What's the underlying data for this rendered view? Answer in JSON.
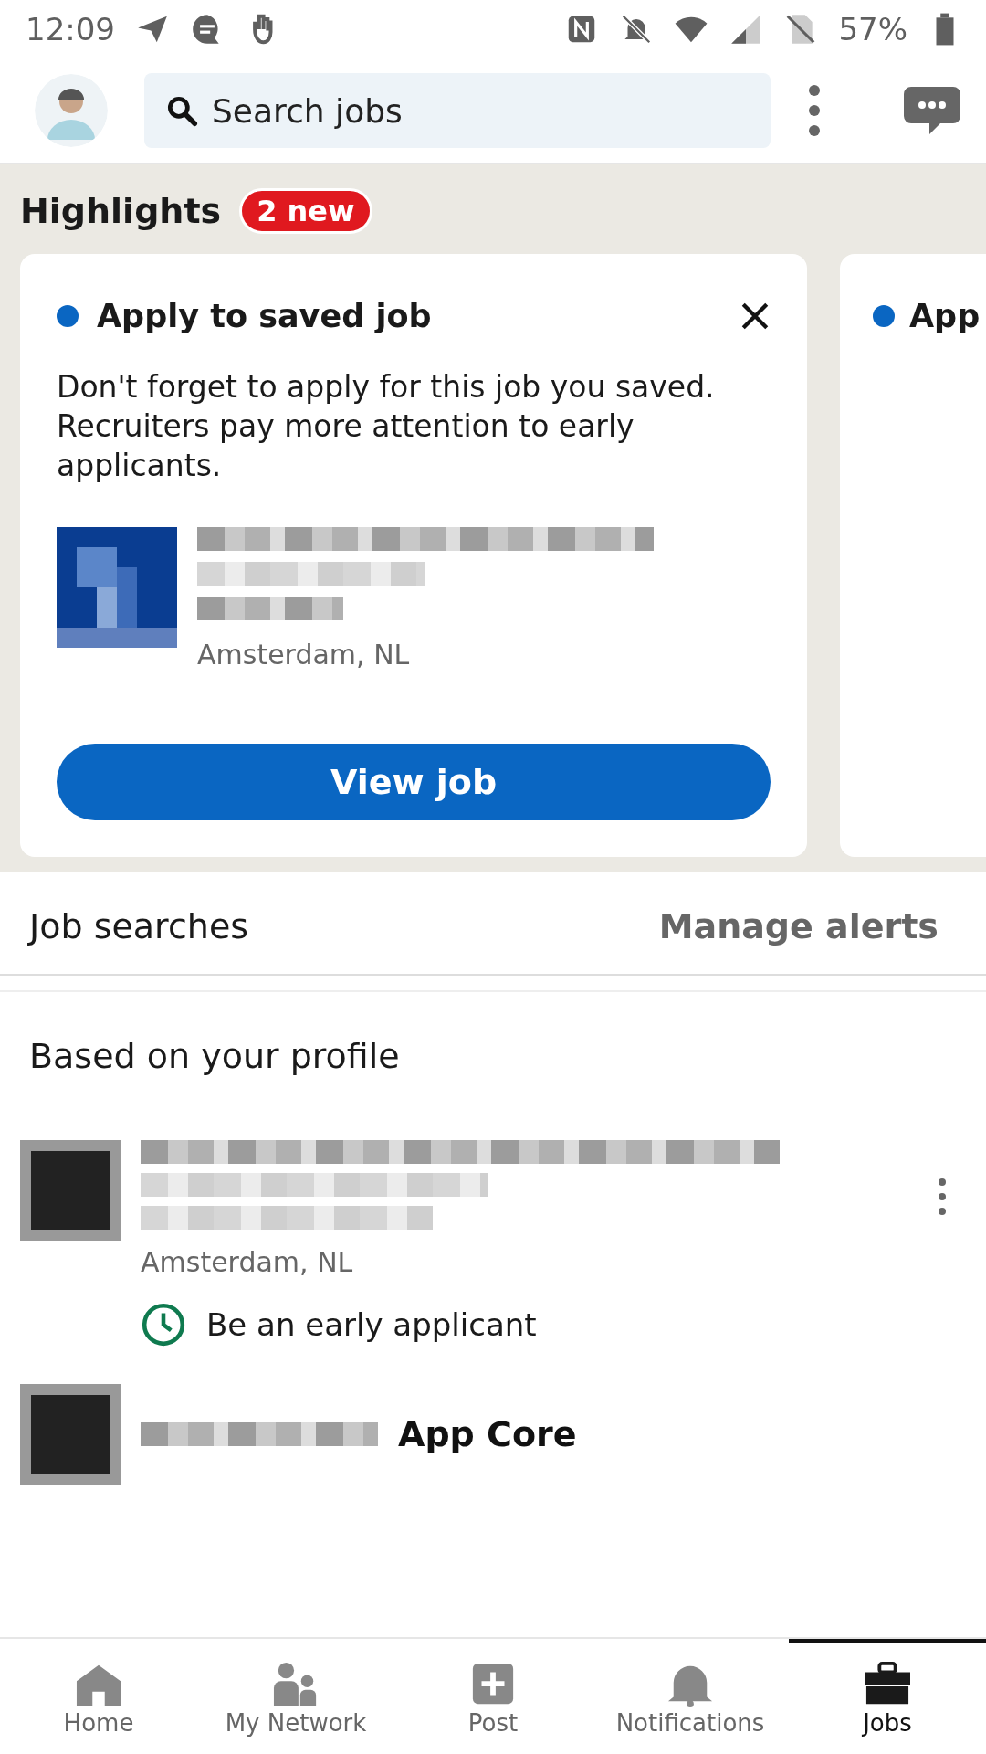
{
  "status_bar": {
    "time": "12:09",
    "battery": "57%"
  },
  "top_bar": {
    "search": {
      "placeholder": "Search jobs"
    }
  },
  "highlights": {
    "title": "Highlights",
    "badge": "2 new",
    "cards": [
      {
        "title": "Apply to saved job",
        "body": "Don't forget to apply for this job you saved. Recruiters pay more attention to early applicants.",
        "location": "Amsterdam, NL",
        "button": "View job"
      },
      {
        "title": "App"
      }
    ]
  },
  "job_searches": {
    "title": "Job searches",
    "action": "Manage alerts"
  },
  "recommendations": {
    "title": "Based on your profile",
    "jobs": [
      {
        "location": "Amsterdam, NL",
        "insight": "Be an early applicant"
      },
      {
        "title_fragment": "App Core"
      }
    ]
  },
  "nav": [
    {
      "label": "Home",
      "kind": "home",
      "selected": false
    },
    {
      "label": "My Network",
      "kind": "network",
      "selected": false
    },
    {
      "label": "Post",
      "kind": "post",
      "selected": false
    },
    {
      "label": "Notifications",
      "kind": "notifications",
      "selected": false
    },
    {
      "label": "Jobs",
      "kind": "jobs",
      "selected": true
    }
  ]
}
